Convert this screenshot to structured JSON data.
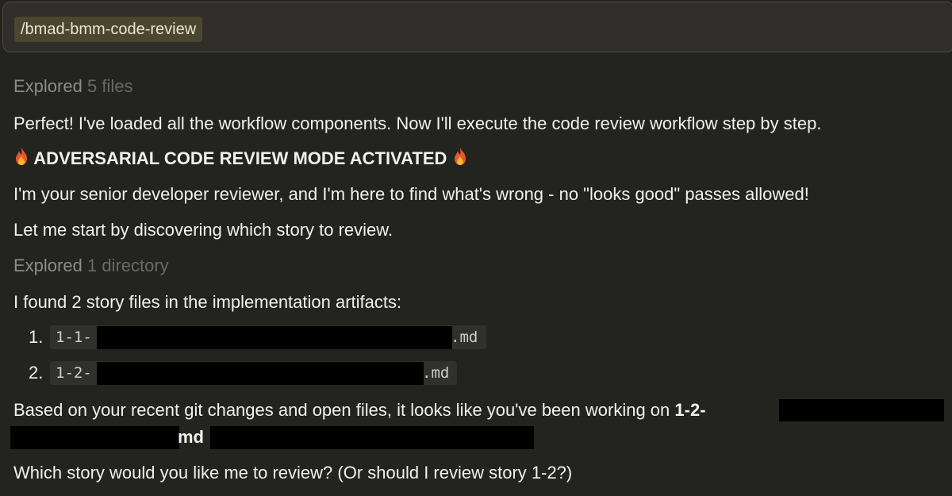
{
  "prompt": {
    "command": "/bmad-bmm-code-review"
  },
  "messages": {
    "explored_1": {
      "label": "Explored",
      "count": "5 files"
    },
    "intro": "Perfect! I've loaded all the workflow components. Now I'll execute the code review workflow step by step.",
    "mode_banner": "ADVERSARIAL CODE REVIEW MODE ACTIVATED",
    "role": "I'm your senior developer reviewer, and I'm here to find what's wrong - no \"looks good\" passes allowed!",
    "start": "Let me start by discovering which story to review.",
    "explored_2": {
      "label": "Explored",
      "count": "1 directory"
    },
    "found": "I found 2 story files in the implementation artifacts:",
    "stories": [
      {
        "num": "1.",
        "prefix": "1-1-",
        "ext": ".md"
      },
      {
        "num": "2.",
        "prefix": "1-2-",
        "ext": ".md"
      }
    ],
    "based_on": "Based on your recent git changes and open files, it looks like you've been working on",
    "based_on_bold": "1-2-",
    "file_ext": "md",
    "question": "Which story would you like me to review? (Or should I review story 1-2?)"
  },
  "icons": {
    "fire_left": "fire-icon",
    "fire_right": "fire-icon"
  },
  "colors": {
    "background": "#232320",
    "chip_background": "#4a4630",
    "redaction": "#000000"
  }
}
